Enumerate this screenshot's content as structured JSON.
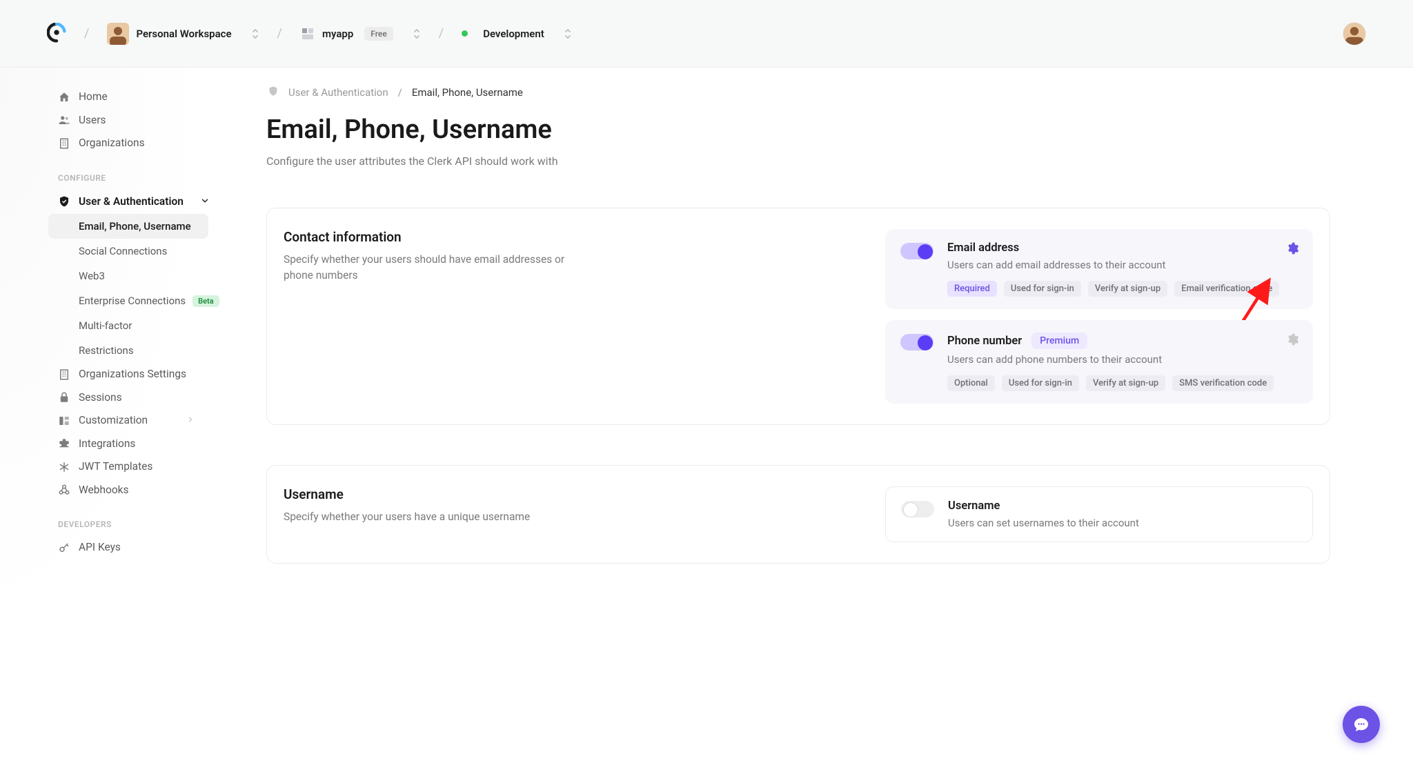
{
  "topbar": {
    "workspace": "Personal Workspace",
    "app_name": "myapp",
    "app_plan": "Free",
    "env": "Development"
  },
  "sidebar": {
    "items": [
      {
        "icon": "home",
        "label": "Home"
      },
      {
        "icon": "users",
        "label": "Users"
      },
      {
        "icon": "org",
        "label": "Organizations"
      }
    ],
    "configure_title": "CONFIGURE",
    "configure": [
      {
        "icon": "shield",
        "label": "User & Authentication",
        "expandable": true
      }
    ],
    "auth_sub": [
      {
        "label": "Email, Phone, Username",
        "active": true
      },
      {
        "label": "Social Connections"
      },
      {
        "label": "Web3"
      },
      {
        "label": "Enterprise Connections",
        "badge": "Beta"
      },
      {
        "label": "Multi-factor"
      },
      {
        "label": "Restrictions"
      }
    ],
    "after_auth": [
      {
        "icon": "org",
        "label": "Organizations Settings"
      },
      {
        "icon": "lock",
        "label": "Sessions"
      },
      {
        "icon": "custom",
        "label": "Customization",
        "chevron": true
      },
      {
        "icon": "plugin",
        "label": "Integrations"
      },
      {
        "icon": "jwt",
        "label": "JWT Templates"
      },
      {
        "icon": "webhook",
        "label": "Webhooks"
      }
    ],
    "developers_title": "DEVELOPERS",
    "developers": [
      {
        "icon": "key",
        "label": "API Keys"
      }
    ]
  },
  "breadcrumb": {
    "root": "User & Authentication",
    "current": "Email, Phone, Username"
  },
  "page": {
    "title": "Email, Phone, Username",
    "subtitle": "Configure the user attributes the Clerk API should work with"
  },
  "contact_card": {
    "title": "Contact information",
    "desc": "Specify whether your users should have email addresses or phone numbers",
    "email": {
      "title": "Email address",
      "desc": "Users can add email addresses to their account",
      "tags": [
        "Required",
        "Used for sign-in",
        "Verify at sign-up",
        "Email verification code"
      ]
    },
    "phone": {
      "title": "Phone number",
      "premium": "Premium",
      "desc": "Users can add phone numbers to their account",
      "tags": [
        "Optional",
        "Used for sign-in",
        "Verify at sign-up",
        "SMS verification code"
      ]
    }
  },
  "username_card": {
    "title": "Username",
    "desc": "Specify whether your users have a unique username",
    "setting": {
      "title": "Username",
      "desc": "Users can set usernames to their account"
    }
  }
}
